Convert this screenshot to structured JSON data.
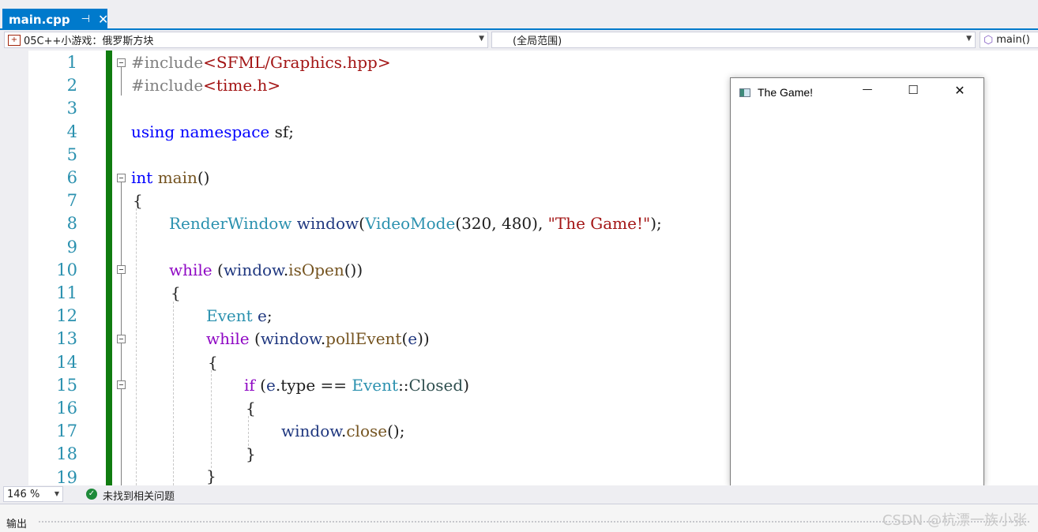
{
  "tab": {
    "label": "main.cpp",
    "pin_glyph": "⊣",
    "close_glyph": "✕"
  },
  "nav": {
    "project": "05C++小游戏：俄罗斯方块",
    "scope": "(全局范围)",
    "member": "main()"
  },
  "line_numbers": [
    "1",
    "2",
    "3",
    "4",
    "5",
    "6",
    "7",
    "8",
    "9",
    "10",
    "11",
    "12",
    "13",
    "14",
    "15",
    "16",
    "17",
    "18",
    "19"
  ],
  "code": {
    "l1_pp": "#include",
    "l1_inc": "<SFML/Graphics.hpp>",
    "l2_pp": "#include",
    "l2_inc": "<time.h>",
    "l4_kw1": "using",
    "l4_kw2": "namespace",
    "l4_rest": "sf;",
    "l6_kw": "int",
    "l6_fn": "main",
    "l6_rest": "()",
    "l7": "{",
    "l8_ty1": "RenderWindow",
    "l8_var": "window",
    "l8_p1": "(",
    "l8_ty2": "VideoMode",
    "l8_nums": "(320, 480), ",
    "l8_str": "\"The Game!\"",
    "l8_end": ");",
    "l10_ctl": "while",
    "l10_p1": " (",
    "l10_var": "window",
    "l10_dot": ".",
    "l10_fn": "isOpen",
    "l10_end": "())",
    "l11": "{",
    "l12_ty": "Event",
    "l12_var": "e",
    "l12_end": ";",
    "l13_ctl": "while",
    "l13_p1": " (",
    "l13_var": "window",
    "l13_dot": ".",
    "l13_fn": "pollEvent",
    "l13_p2": "(",
    "l13_var2": "e",
    "l13_end": "))",
    "l14": "{",
    "l15_ctl": "if",
    "l15_p1": " (",
    "l15_var": "e",
    "l15_dot": ".",
    "l15_mem": "type",
    "l15_op": " == ",
    "l15_ty": "Event",
    "l15_sep": "::",
    "l15_en": "Closed",
    "l15_end": ")",
    "l16": "{",
    "l17_var": "window",
    "l17_dot": ".",
    "l17_fn": "close",
    "l17_end": "();",
    "l18": "}",
    "l19": "}"
  },
  "game_window": {
    "title": "The Game!",
    "minimize_glyph": "—",
    "maximize_glyph": "☐",
    "close_glyph": "✕"
  },
  "status": {
    "zoom": "146 %",
    "issues": "未找到相关问题"
  },
  "output": {
    "label": "输出",
    "watermark": "CSDN @杭漂一族小张"
  },
  "colors": {
    "accent": "#007acc",
    "change_bar": "#107c10",
    "keyword": "#0000ff",
    "control": "#8f08c4",
    "string": "#a31515",
    "type": "#2b91af"
  }
}
